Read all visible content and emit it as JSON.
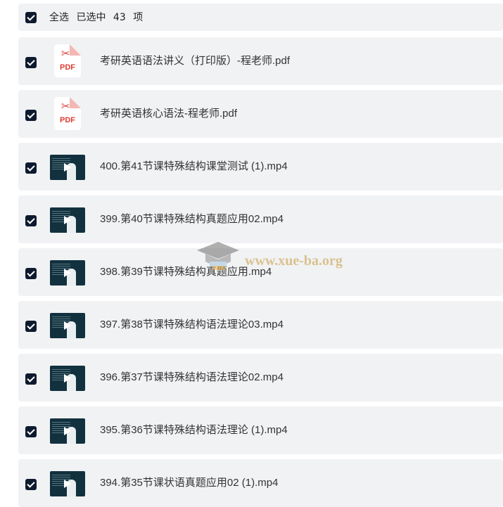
{
  "header": {
    "select_all_label": "全选",
    "selected_prefix": "已选中",
    "selected_count": "43",
    "selected_suffix": "项",
    "checked": true
  },
  "files": [
    {
      "name": "考研英语语法讲义（打印版）-程老师.pdf",
      "type": "pdf",
      "checked": true
    },
    {
      "name": "考研英语核心语法-程老师.pdf",
      "type": "pdf",
      "checked": true
    },
    {
      "name": "400.第41节课特殊结构课堂测试 (1).mp4",
      "type": "video",
      "checked": true
    },
    {
      "name": "399.第40节课特殊结构真题应用02.mp4",
      "type": "video",
      "checked": true
    },
    {
      "name": "398.第39节课特殊结构真题应用.mp4",
      "type": "video",
      "checked": true
    },
    {
      "name": "397.第38节课特殊结构语法理论03.mp4",
      "type": "video",
      "checked": true
    },
    {
      "name": "396.第37节课特殊结构语法理论02.mp4",
      "type": "video",
      "checked": true
    },
    {
      "name": "395.第36节课特殊结构语法理论 (1).mp4",
      "type": "video",
      "checked": true
    },
    {
      "name": "394.第35节课状语真题应用02 (1).mp4",
      "type": "video",
      "checked": true
    }
  ],
  "pdf_badge": "PDF",
  "watermark": {
    "text": "www.xue-ba.org",
    "icon": "graduation-cap-icon"
  },
  "colors": {
    "checkbox": "#0e1a2e",
    "row_bg": "#f1f2f4",
    "pdf_red": "#e23b32",
    "video_bg": "#12313e"
  }
}
